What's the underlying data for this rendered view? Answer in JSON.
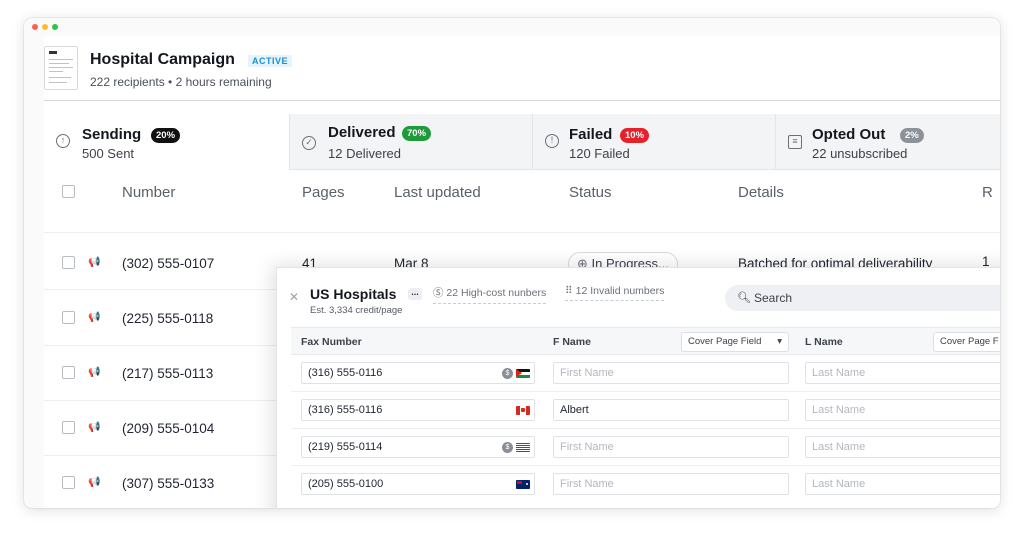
{
  "campaign": {
    "title": "Hospital Campaign",
    "status": "ACTIVE",
    "subtitle": "222 recipients • 2 hours remaining"
  },
  "tabs": [
    {
      "label": "Sending",
      "pct": "20%",
      "sub": "500 Sent",
      "pct_color": "#111111",
      "icon": "arrow-up-circle-icon"
    },
    {
      "label": "Delivered",
      "pct": "70%",
      "sub": "12 Delivered",
      "pct_color": "#1e9a3b",
      "icon": "check-circle-icon"
    },
    {
      "label": "Failed",
      "pct": "10%",
      "sub": "120 Failed",
      "pct_color": "#e5222a",
      "icon": "alert-circle-icon"
    },
    {
      "label": "Opted Out",
      "pct": "2%",
      "sub": "22 unsubscribed",
      "pct_color": "#8d929a",
      "icon": "opt-out-icon"
    }
  ],
  "table": {
    "columns": [
      "Number",
      "Pages",
      "Last updated",
      "Status",
      "Details",
      "R"
    ],
    "rows": [
      {
        "number": "(302) 555-0107",
        "pages": "41",
        "updated": "Mar 8",
        "status": "In Progress...",
        "details": "Batched for optimal deliverability",
        "r": "1"
      },
      {
        "number": "(225) 555-0118"
      },
      {
        "number": "(217) 555-0113"
      },
      {
        "number": "(209) 555-0104"
      },
      {
        "number": "(307) 555-0133"
      }
    ]
  },
  "panel": {
    "title": "US Hospitals",
    "estimate": "Est. 3,334 credit/page",
    "chip_high_cost": "22 High-cost nunbers",
    "chip_invalid": "12 Invalid numbers",
    "search_placeholder": "Search",
    "columns": {
      "fax": "Fax Number",
      "fname": "F Name",
      "lname": "L Name",
      "cover_field": "Cover Page Field",
      "cover_field_cut": "Cover Page F"
    },
    "rows": [
      {
        "fax": "(316) 555-0116",
        "fname": "First Name",
        "lname": "Last Name",
        "coin": true,
        "flag": "palestine"
      },
      {
        "fax": "(316) 555-0116",
        "fname": "Albert",
        "lname": "Last Name",
        "coin": false,
        "flag": "canada"
      },
      {
        "fax": "(219) 555-0114",
        "fname": "First Name",
        "lname": "Last Name",
        "coin": true,
        "flag": "greece"
      },
      {
        "fax": "(205) 555-0100",
        "fname": "First Name",
        "lname": "Last Name",
        "coin": false,
        "flag": "australia"
      }
    ]
  }
}
